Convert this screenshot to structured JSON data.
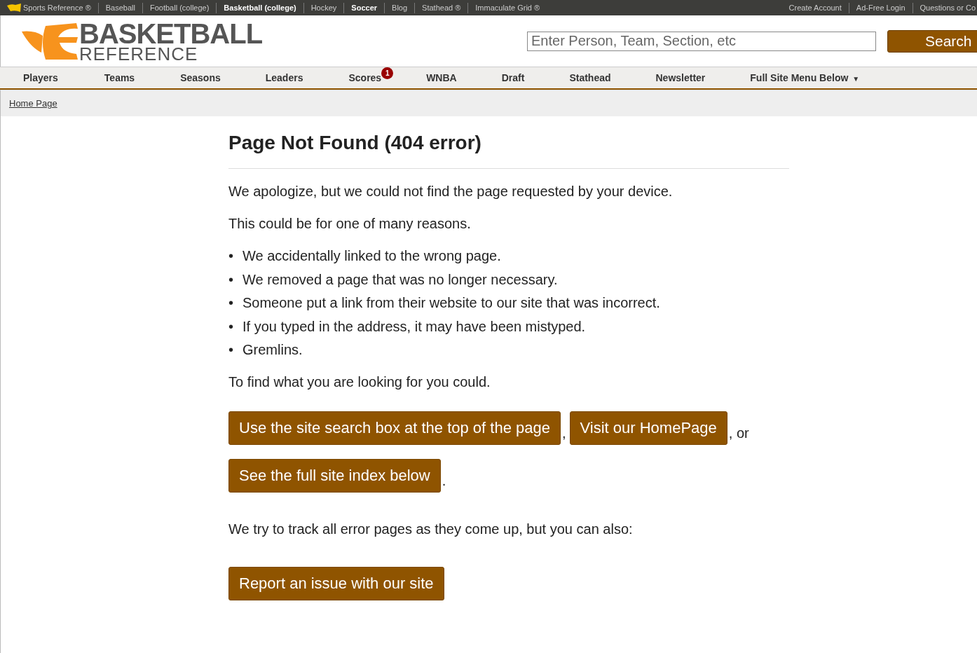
{
  "top_bar": {
    "left_links": [
      {
        "label": "Sports Reference ®",
        "emphasized": false,
        "logo": true
      },
      {
        "label": "Baseball",
        "emphasized": false
      },
      {
        "label": "Football (college)",
        "emphasized": false
      },
      {
        "label": "Basketball (college)",
        "emphasized": true
      },
      {
        "label": "Hockey",
        "emphasized": false
      },
      {
        "label": "Soccer",
        "emphasized": true
      },
      {
        "label": "Blog",
        "emphasized": false
      },
      {
        "label": "Stathead ®",
        "emphasized": false
      },
      {
        "label": "Immaculate Grid ®",
        "emphasized": false
      }
    ],
    "right_links": [
      "Create Account",
      "Ad-Free Login",
      "Questions or Co"
    ]
  },
  "header": {
    "logo": {
      "line_1": "BASKETBALL",
      "line_2": "REFERENCE"
    },
    "search": {
      "placeholder": "Enter Person, Team, Section, etc",
      "button": "Search"
    }
  },
  "nav": [
    {
      "label": "Players"
    },
    {
      "label": "Teams"
    },
    {
      "label": "Seasons"
    },
    {
      "label": "Leaders"
    },
    {
      "label": "Scores",
      "badge": "1"
    },
    {
      "label": "WNBA"
    },
    {
      "label": "Draft"
    },
    {
      "label": "Stathead"
    },
    {
      "label": "Newsletter"
    },
    {
      "label": "Full Site Menu Below",
      "dropdown": "▼"
    }
  ],
  "breadcrumb": "Home Page",
  "content": {
    "title": "Page Not Found (404 error)",
    "intro": [
      "We apologize, but we could not find the page requested by your device.",
      "This could be for one of many reasons."
    ],
    "bullet": "•",
    "reasons": [
      "We accidentally linked to the wrong page.",
      "We removed a page that was no longer necessary.",
      "Someone put a link from their website to our site that was incorrect.",
      "If you typed in the address, it may have been mistyped.",
      "Gremlins."
    ],
    "find_text": "To find what you are looking for you could.",
    "option_rows": [
      [
        {
          "kind": "button",
          "text": "Use the site search box at the top of the page"
        },
        {
          "kind": "text",
          "text": ","
        },
        {
          "kind": "button",
          "text": "Visit our HomePage"
        },
        {
          "kind": "text",
          "text": ", or"
        }
      ],
      [
        {
          "kind": "button",
          "text": "See the full site index below"
        },
        {
          "kind": "text",
          "text": "."
        }
      ]
    ],
    "track_text": "We try to track all error pages as they come up, but you can also:",
    "report_button": "Report an issue with our site"
  }
}
